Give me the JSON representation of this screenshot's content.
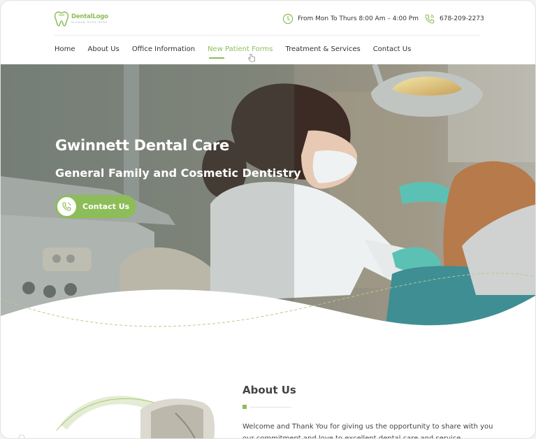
{
  "logo": {
    "title": "DentalLogo",
    "tagline": "SLOGAN GOES HERE"
  },
  "header": {
    "hours": "From Mon To Thurs 8:00 Am – 4:00 Pm",
    "phone": "678-209-2273"
  },
  "nav": {
    "items": [
      {
        "label": "Home"
      },
      {
        "label": "About Us"
      },
      {
        "label": "Office Information"
      },
      {
        "label": "New Patient Forms",
        "active": true
      },
      {
        "label": "Treatment & Services"
      },
      {
        "label": "Contact Us"
      }
    ]
  },
  "hero": {
    "title": "Gwinnett Dental Care",
    "subtitle": "General Family and Cosmetic Dentistry",
    "cta_label": "Contact Us"
  },
  "about": {
    "title": "About Us",
    "text": "Welcome and Thank You for giving us the opportunity to share with you our commitment and love to excellent dental care and service."
  },
  "icons": {
    "logo": "tooth-icon",
    "hours": "clock-icon",
    "phone": "phone-icon",
    "cta": "phone-icon",
    "cursor": "hand-pointer-icon"
  },
  "colors": {
    "accent": "#8dbd58",
    "text": "#333333",
    "hero_overlay": "#6e7a70"
  }
}
